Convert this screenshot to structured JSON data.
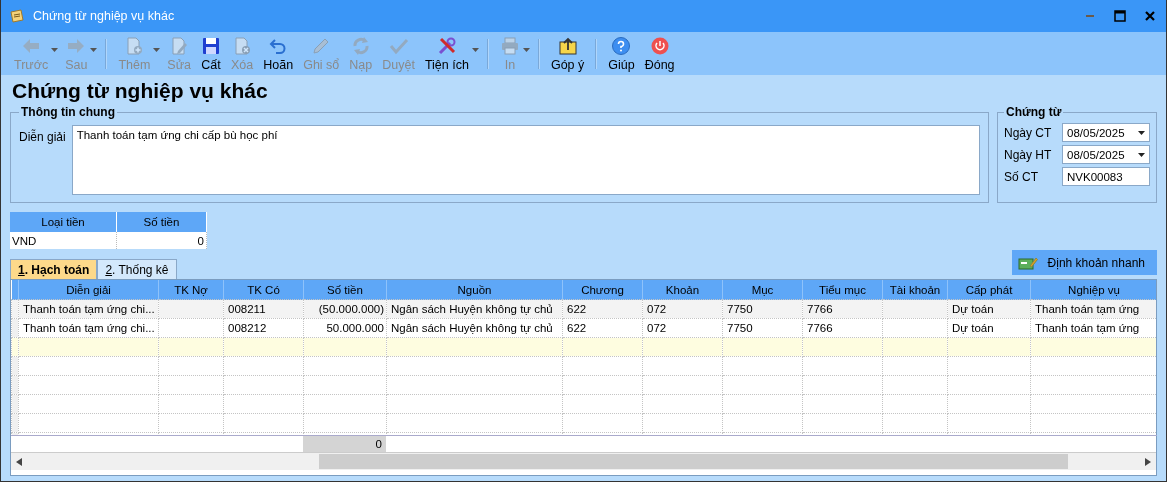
{
  "window": {
    "title": "Chứng từ nghiệp vụ khác"
  },
  "toolbar": [
    {
      "kind": "back",
      "label": "Trước",
      "enabled": false,
      "dropdown": true,
      "separator_before": false
    },
    {
      "kind": "forward",
      "label": "Sau",
      "enabled": false,
      "dropdown": true,
      "separator_before": false
    },
    {
      "kind": "add",
      "label": "Thêm",
      "enabled": false,
      "dropdown": true,
      "separator_before": true
    },
    {
      "kind": "edit",
      "label": "Sửa",
      "enabled": false,
      "dropdown": false,
      "separator_before": false
    },
    {
      "kind": "save",
      "label": "Cất",
      "enabled": true,
      "dropdown": false,
      "separator_before": false
    },
    {
      "kind": "delete",
      "label": "Xóa",
      "enabled": false,
      "dropdown": false,
      "separator_before": false
    },
    {
      "kind": "undo",
      "label": "Hoãn",
      "enabled": true,
      "dropdown": false,
      "separator_before": false
    },
    {
      "kind": "post",
      "label": "Ghi sổ",
      "enabled": false,
      "dropdown": false,
      "separator_before": false
    },
    {
      "kind": "reload",
      "label": "Nạp",
      "enabled": false,
      "dropdown": false,
      "separator_before": false
    },
    {
      "kind": "approve",
      "label": "Duyệt",
      "enabled": false,
      "dropdown": false,
      "separator_before": false
    },
    {
      "kind": "tools",
      "label": "Tiện ích",
      "enabled": true,
      "dropdown": true,
      "separator_before": false
    },
    {
      "kind": "print",
      "label": "In",
      "enabled": false,
      "dropdown": true,
      "separator_before": true
    },
    {
      "kind": "feedback",
      "label": "Góp ý",
      "enabled": true,
      "dropdown": false,
      "separator_before": true
    },
    {
      "kind": "help",
      "label": "Giúp",
      "enabled": true,
      "dropdown": false,
      "separator_before": true
    },
    {
      "kind": "close",
      "label": "Đóng",
      "enabled": true,
      "dropdown": false,
      "separator_before": false
    }
  ],
  "heading": "Chứng từ nghiệp vụ khác",
  "general": {
    "legend": "Thông tin chung",
    "label": "Diễn giải",
    "value": "Thanh toán tạm ứng chi cấp bù học phí"
  },
  "voucher": {
    "legend": "Chứng từ",
    "fields": [
      {
        "kind": "date",
        "label": "Ngày CT",
        "value": "08/05/2025"
      },
      {
        "kind": "date",
        "label": "Ngày HT",
        "value": "08/05/2025"
      },
      {
        "kind": "text",
        "label": "Số CT",
        "value": "NVK00083"
      }
    ]
  },
  "currency": {
    "columns": [
      "Loại tiền",
      "Số tiền"
    ],
    "row": [
      "VND",
      "0"
    ]
  },
  "tabs": [
    {
      "key": "1",
      "label": ". Hạch toán",
      "selected": true
    },
    {
      "key": "2",
      "label": ". Thống kê",
      "selected": false
    }
  ],
  "quick_button": "Định khoản nhanh",
  "grid": {
    "columns": [
      {
        "label": "Diễn giải"
      },
      {
        "label": "TK Nợ"
      },
      {
        "label": "TK Có"
      },
      {
        "label": "Số tiền",
        "total": "0"
      },
      {
        "label": "Nguồn"
      },
      {
        "label": "Chương"
      },
      {
        "label": "Khoản"
      },
      {
        "label": "Mục"
      },
      {
        "label": "Tiểu mục"
      },
      {
        "label": "Tài khoản"
      },
      {
        "label": "Cấp phát"
      },
      {
        "label": "Nghiệp vụ"
      }
    ],
    "rows": [
      {
        "selected": true,
        "cells": [
          "Thanh toán tạm ứng chi...",
          "",
          "008211",
          "(50.000.000)",
          "Ngân sách Huyện không tự chủ",
          "622",
          "072",
          "7750",
          "7766",
          "",
          "Dự toán",
          "Thanh toán tạm ứng"
        ]
      },
      {
        "selected": false,
        "cells": [
          "Thanh toán tạm ứng chi...",
          "",
          "008212",
          "50.000.000",
          "Ngân sách Huyện không tự chủ",
          "622",
          "072",
          "7750",
          "7766",
          "",
          "Dự toán",
          "Thanh toán tạm ứng"
        ]
      }
    ]
  }
}
